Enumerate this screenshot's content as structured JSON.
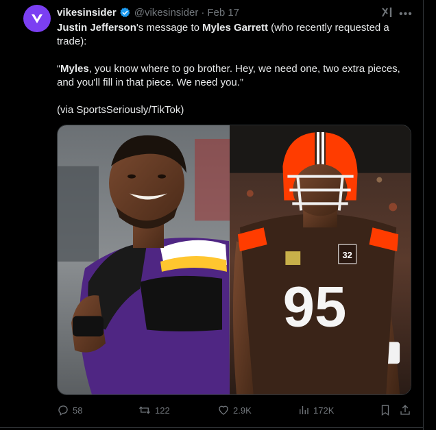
{
  "tweet": {
    "display_name": "vikesinsider",
    "handle": "@vikesinsider",
    "separator": "·",
    "date": "Feb 17",
    "avatar_letter": "V",
    "para1": {
      "name1": "Justin Jefferson",
      "mid": "'s message to ",
      "name2": "Myles Garrett",
      "rest": " (who recently requested a trade):"
    },
    "para2": {
      "open_quote": "“",
      "name": "Myles",
      "rest": ", you know where to go brother. Hey, we need one, two extra pieces, and you'll fill in that piece. We need you.”"
    },
    "para3": "(via SportsSeriously/TikTok)"
  },
  "media": {
    "left_jersey_number": "",
    "right_jersey_number": "95",
    "right_patch_number": "32"
  },
  "actions": {
    "replies": "58",
    "reposts": "122",
    "likes": "2.9K",
    "views": "172K"
  },
  "icons": {
    "verified": "verified-badge-icon",
    "grok": "grok-icon",
    "more": "more-icon",
    "reply": "reply-icon",
    "repost": "repost-icon",
    "like": "like-icon",
    "views": "views-icon",
    "bookmark": "bookmark-icon",
    "share": "share-icon"
  },
  "colors": {
    "background": "#000000",
    "text": "#e7e9ea",
    "muted": "#71767b",
    "verified": "#1d9bf0",
    "avatar": "#7b3ff2",
    "vikings_purple": "#4f2683",
    "browns_brown": "#311d00",
    "browns_orange": "#ff3c00"
  }
}
